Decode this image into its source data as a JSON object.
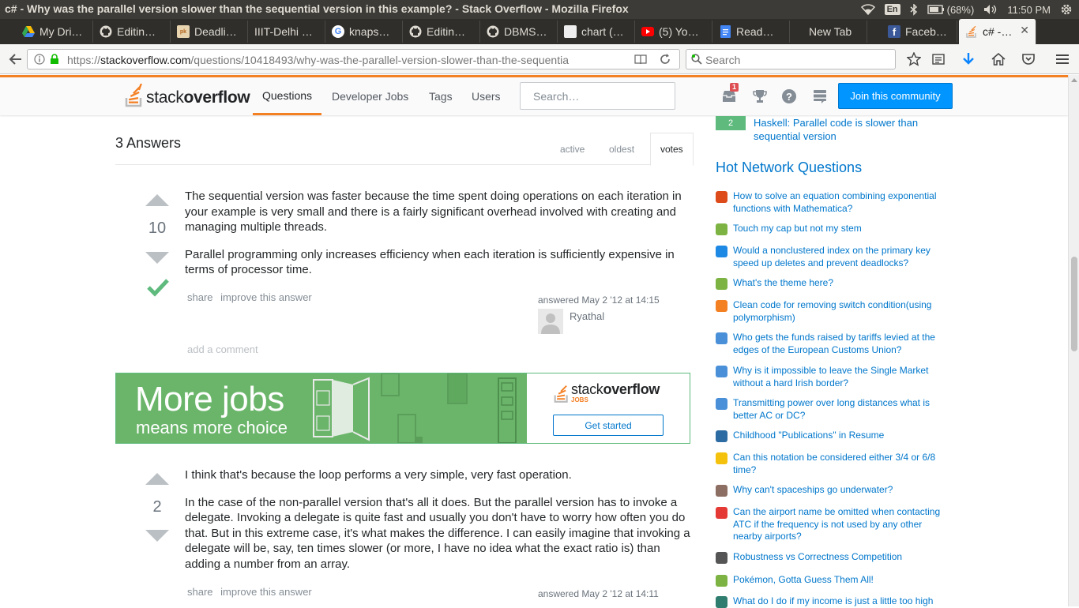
{
  "os": {
    "title": "c# - Why was the parallel version slower than the sequential version in this example? - Stack Overflow - Mozilla Firefox",
    "lang": "En",
    "battery": "(68%)",
    "clock": "11:50 PM"
  },
  "tabs": [
    {
      "label": "My Dri…",
      "icon": "google-drive-icon",
      "color": "#fbbc05"
    },
    {
      "label": "Editin…",
      "icon": "github-icon",
      "color": "#ffffff"
    },
    {
      "label": "Deadli…",
      "icon": "page-icon",
      "color": "#e8d5b0"
    },
    {
      "label": "IIIT-Delhi …",
      "icon": "none",
      "color": ""
    },
    {
      "label": "knaps…",
      "icon": "google-icon",
      "color": "#ffffff"
    },
    {
      "label": "Editin…",
      "icon": "github-icon",
      "color": "#ffffff"
    },
    {
      "label": "DBMS…",
      "icon": "github-icon",
      "color": "#ffffff"
    },
    {
      "label": "chart (…",
      "icon": "blank-page-icon",
      "color": "#eeeeee"
    },
    {
      "label": "(5) Yo…",
      "icon": "youtube-icon",
      "color": "#ff0000"
    },
    {
      "label": "Read…",
      "icon": "docs-icon",
      "color": "#4285f4"
    },
    {
      "label": "New Tab",
      "icon": "none",
      "color": ""
    },
    {
      "label": "Faceb…",
      "icon": "facebook-icon",
      "color": "#3b5998"
    },
    {
      "label": "c# -…",
      "icon": "stackoverflow-icon",
      "color": "#f48024"
    }
  ],
  "navbar": {
    "url_prefix": "https://",
    "url_domain": "stackoverflow.com",
    "url_path": "/questions/10418493/why-was-the-parallel-version-slower-than-the-sequentia",
    "search_placeholder": "Search"
  },
  "so_header": {
    "logo_light": "stack",
    "logo_bold": "overflow",
    "nav": [
      "Questions",
      "Developer Jobs",
      "Tags",
      "Users"
    ],
    "search_placeholder": "Search…",
    "inbox_count": "1",
    "join_label": "Join this community"
  },
  "answers_header": {
    "count_label": "3 Answers",
    "sort_tabs": [
      "active",
      "oldest",
      "votes"
    ]
  },
  "answers": [
    {
      "votes": "10",
      "paragraphs": [
        "The sequential version was faster because the time spent doing operations on each iteration in your example is very small and there is a fairly significant overhead involved with creating and managing multiple threads.",
        "Parallel programming only increases efficiency when each iteration is sufficiently expensive in terms of processor time."
      ],
      "share": "share",
      "improve": "improve this answer",
      "answered": "answered May 2 '12 at 14:15",
      "user": "Ryathal",
      "add_comment": "add a comment"
    },
    {
      "votes": "2",
      "paragraphs": [
        "I think that's because the loop performs a very simple, very fast operation.",
        "In the case of the non-parallel version that's all it does. But the parallel version has to invoke a delegate. Invoking a delegate is quite fast and usually you don't have to worry how often you do that. But in this extreme case, it's what makes the difference. I can easily imagine that invoking a delegate will be, say, ten times slower (or more, I have no idea what the exact ratio is) than adding a number from an array."
      ],
      "share": "share",
      "improve": "improve this answer",
      "answered": "answered May 2 '12 at 14:11"
    }
  ],
  "ad": {
    "title": "More jobs",
    "subtitle": "means more choice",
    "logo_light": "stack",
    "logo_bold": "overflow",
    "logo_sub": "JOBS",
    "button": "Get started"
  },
  "sidebar": {
    "related": {
      "score": "2",
      "title": "Haskell: Parallel code is slower than sequential version"
    },
    "hnq_title": "Hot Network Questions",
    "hnq": [
      {
        "title": "How to solve an equation combining exponential functions with Mathematica?",
        "icon": "mathematica-icon",
        "color": "#dd4b1a"
      },
      {
        "title": "Touch my cap but not my stem",
        "icon": "puzzling-icon",
        "color": "#7cb342"
      },
      {
        "title": "Would a nonclustered index on the primary key speed up deletes and prevent deadlocks?",
        "icon": "dba-icon",
        "color": "#1e88e5"
      },
      {
        "title": "What's the theme here?",
        "icon": "puzzling-icon",
        "color": "#7cb342"
      },
      {
        "title": "Clean code for removing switch condition(using polymorphism)",
        "icon": "softwareengineering-icon",
        "color": "#f48024"
      },
      {
        "title": "Who gets the funds raised by tariffs levied at the edges of the European Customs Union?",
        "icon": "politics-icon",
        "color": "#4a90d9"
      },
      {
        "title": "Why is it impossible to leave the Single Market without a hard Irish border?",
        "icon": "politics-icon",
        "color": "#4a90d9"
      },
      {
        "title": "Transmitting power over long distances what is better AC or DC?",
        "icon": "electronics-icon",
        "color": "#4a90d9"
      },
      {
        "title": "Childhood \"Publications\" in Resume",
        "icon": "workplace-icon",
        "color": "#2d6ca2"
      },
      {
        "title": "Can this notation be considered either 3/4 or 6/8 time?",
        "icon": "music-icon",
        "color": "#f4c20d"
      },
      {
        "title": "Why can't spaceships go underwater?",
        "icon": "worldbuilding-icon",
        "color": "#8d6e63"
      },
      {
        "title": "Can the airport name be omitted when contacting ATC if the frequency is not used by any other nearby airports?",
        "icon": "aviation-icon",
        "color": "#e53935"
      },
      {
        "title": "Robustness vs Correctness Competition",
        "icon": "codegolf-icon",
        "color": "#555555"
      },
      {
        "title": "Pokémon, Gotta Guess Them All!",
        "icon": "puzzling-icon",
        "color": "#7cb342"
      },
      {
        "title": "What do I do if my income is just a little too high",
        "icon": "money-icon",
        "color": "#2e7d6e"
      }
    ]
  }
}
